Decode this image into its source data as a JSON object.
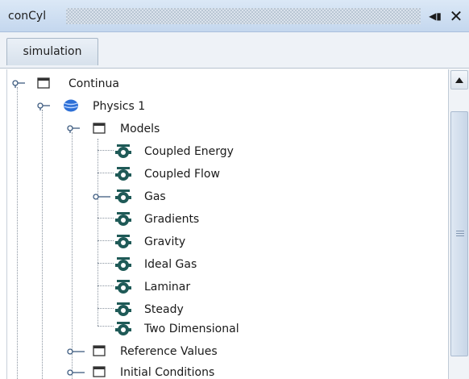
{
  "window": {
    "title": "conCyl",
    "minimize_icon": "◀▮",
    "close_icon": "✕"
  },
  "tabs": [
    {
      "label": "simulation"
    }
  ],
  "tree": {
    "continua": {
      "label": "Continua",
      "icon": "folder-icon",
      "physics": {
        "label": "Physics 1",
        "icon": "physics-continuum-icon",
        "models": {
          "label": "Models",
          "icon": "folder-icon",
          "items": [
            {
              "label": "Coupled Energy",
              "icon": "model-icon",
              "expandable": false
            },
            {
              "label": "Coupled Flow",
              "icon": "model-icon",
              "expandable": false
            },
            {
              "label": "Gas",
              "icon": "model-icon",
              "expandable": true
            },
            {
              "label": "Gradients",
              "icon": "model-icon",
              "expandable": false
            },
            {
              "label": "Gravity",
              "icon": "model-icon",
              "expandable": false
            },
            {
              "label": "Ideal Gas",
              "icon": "model-icon",
              "expandable": false
            },
            {
              "label": "Laminar",
              "icon": "model-icon",
              "expandable": false
            },
            {
              "label": "Steady",
              "icon": "model-icon",
              "expandable": false
            },
            {
              "label": "Two Dimensional",
              "icon": "model-icon",
              "expandable": false
            }
          ]
        },
        "reference_values": {
          "label": "Reference Values",
          "icon": "folder-icon"
        },
        "initial_conditions": {
          "label": "Initial Conditions",
          "icon": "folder-icon"
        }
      }
    }
  },
  "colors": {
    "titlebar": "#c4d7ee",
    "physics_icon": "#2d6fd6",
    "model_icon": "#1f5a57",
    "tree_lines": "#8a94a0"
  }
}
